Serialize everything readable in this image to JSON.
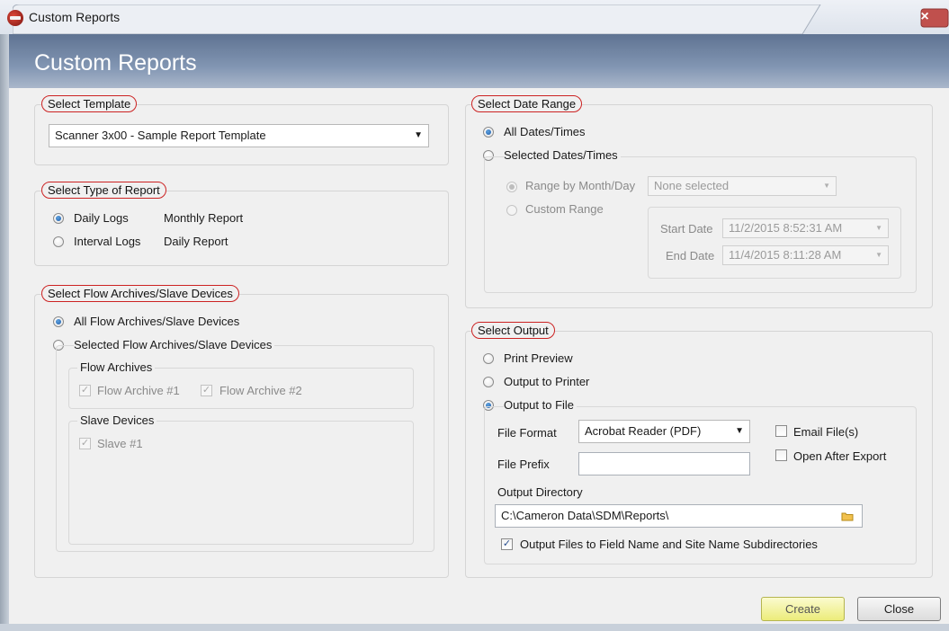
{
  "window": {
    "title": "Custom Reports",
    "header": "Custom Reports",
    "close_glyph": "×",
    "icon": "app-logo-icon"
  },
  "template_group": {
    "legend": "Select Template",
    "selected": "Scanner 3x00 - Sample Report Template"
  },
  "report_type_group": {
    "legend": "Select Type of Report",
    "options": [
      {
        "label": "Daily Logs",
        "desc": "Monthly Report",
        "checked": true
      },
      {
        "label": "Interval Logs",
        "desc": "Daily Report",
        "checked": false
      }
    ]
  },
  "flow_group": {
    "legend": "Select Flow Archives/Slave Devices",
    "all_label": "All Flow Archives/Slave Devices",
    "selected_label": "Selected Flow Archives/Slave Devices",
    "archives_legend": "Flow Archives",
    "archives": [
      "Flow Archive #1",
      "Flow Archive #2"
    ],
    "slaves_legend": "Slave Devices",
    "slaves": [
      "Slave #1"
    ]
  },
  "date_group": {
    "legend": "Select Date Range",
    "all_label": "All Dates/Times",
    "selected_label": "Selected Dates/Times",
    "range_month_label": "Range by Month/Day",
    "range_month_value": "None selected",
    "custom_label": "Custom Range",
    "start_label": "Start Date",
    "start_value": "11/2/2015 8:52:31 AM",
    "end_label": "End Date",
    "end_value": "11/4/2015 8:11:28 AM"
  },
  "output_group": {
    "legend": "Select Output",
    "options": [
      "Print Preview",
      "Output to Printer",
      "Output to File"
    ],
    "checked_index": 2,
    "file_format_label": "File Format",
    "file_format_value": "Acrobat Reader (PDF)",
    "email_label": "Email File(s)",
    "open_after_label": "Open After Export",
    "file_prefix_label": "File Prefix",
    "file_prefix_value": "",
    "output_dir_label": "Output Directory",
    "output_dir_value": "C:\\Cameron Data\\SDM\\Reports\\",
    "subdir_label": "Output Files to Field Name and Site Name Subdirectories",
    "subdir_checked": true
  },
  "buttons": {
    "create": "Create",
    "close": "Close"
  },
  "colors": {
    "header_band": "#7185a4",
    "legend_outline": "#cc2222",
    "create_button": "#f0f08a",
    "close_button": "#c0504d"
  }
}
